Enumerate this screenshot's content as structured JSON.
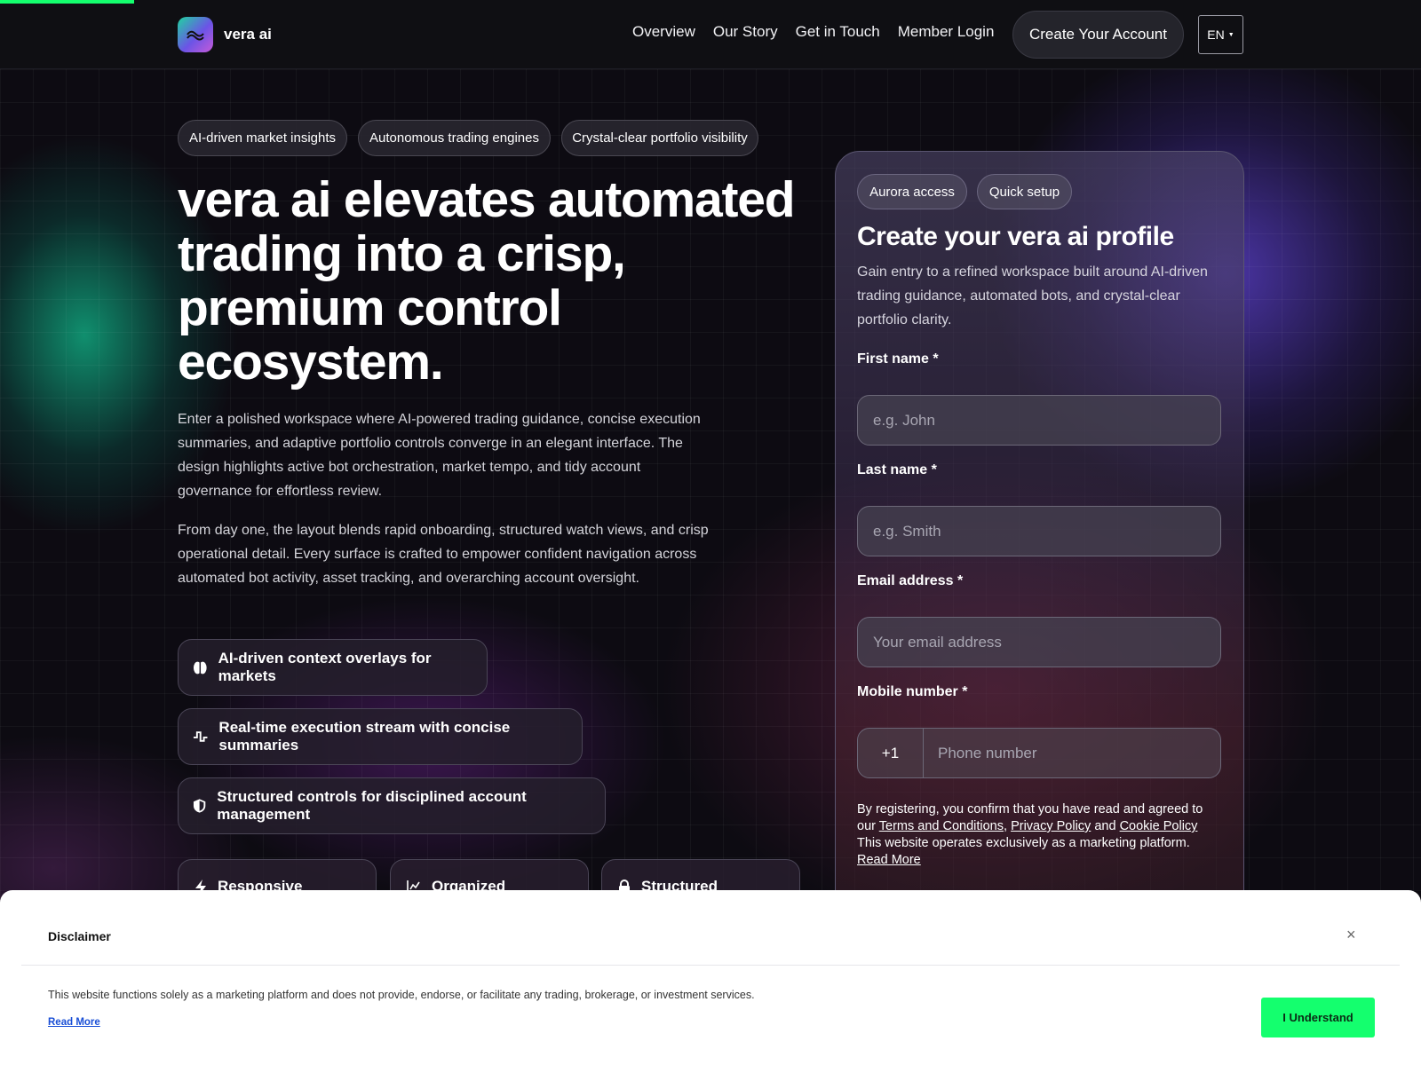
{
  "header": {
    "brand": "vera ai",
    "nav": [
      "Overview",
      "Our Story",
      "Get in Touch",
      "Member Login"
    ],
    "cta": "Create Your Account",
    "lang": "EN"
  },
  "hero": {
    "chips": [
      "AI-driven market insights",
      "Autonomous trading engines",
      "Crystal-clear portfolio visibility"
    ],
    "title": "vera ai elevates automated trading into a crisp, premium control ecosystem.",
    "paragraph1": "Enter a polished workspace where AI-powered trading guidance, concise execution summaries, and adaptive portfolio controls converge in an elegant interface. The design highlights active bot orchestration, market tempo, and tidy account governance for effortless review.",
    "paragraph2": "From day one, the layout blends rapid onboarding, structured watch views, and crisp operational detail. Every surface is crafted to empower confident navigation across automated bot activity, asset tracking, and overarching account oversight.",
    "features": [
      "AI-driven context overlays for markets",
      "Real-time execution stream with concise summaries",
      "Structured controls for disciplined account management"
    ],
    "mini_cards": [
      "Responsive",
      "Organized",
      "Structured"
    ]
  },
  "form": {
    "chips": [
      "Aurora access",
      "Quick setup"
    ],
    "title": "Create your vera ai profile",
    "subtitle": "Gain entry to a refined workspace built around AI-driven trading guidance, automated bots, and crystal-clear portfolio clarity.",
    "first_name": {
      "label": "First name *",
      "placeholder": "e.g. John"
    },
    "last_name": {
      "label": "Last name *",
      "placeholder": "e.g. Smith"
    },
    "email": {
      "label": "Email address *",
      "placeholder": "Your email address"
    },
    "mobile": {
      "label": "Mobile number *",
      "code": "+1",
      "placeholder": "Phone number"
    },
    "legal": {
      "prefix": "By registering, you confirm that you have read and agreed to our",
      "terms": "Terms and Conditions",
      "comma": ",",
      "privacy": "Privacy Policy",
      "and": "and",
      "cookie": "Cookie Policy",
      "note": "This website operates exclusively as a marketing platform.",
      "read_more": "Read More"
    }
  },
  "disclaimer": {
    "title": "Disclaimer",
    "close": "×",
    "text": "This website functions solely as a marketing platform and does not provide, endorse, or facilitate any trading, brokerage, or investment services.",
    "read_more": "Read More",
    "button": "I Understand"
  },
  "colors": {
    "accent": "#14ff6e",
    "background": "#0b0a10"
  }
}
